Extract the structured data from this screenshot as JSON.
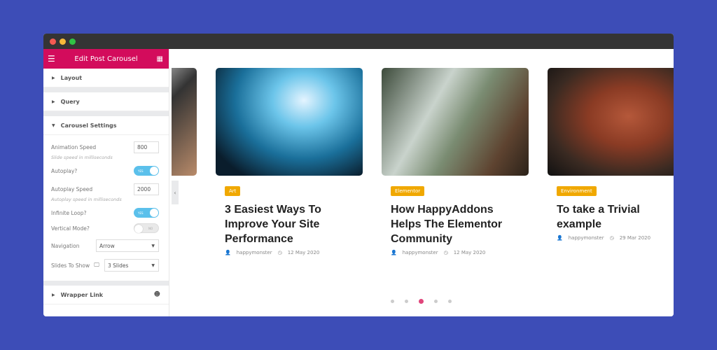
{
  "panel": {
    "title": "Edit Post Carousel",
    "sections": {
      "layout": "Layout",
      "query": "Query",
      "carousel": "Carousel Settings",
      "wrapper": "Wrapper Link"
    },
    "fields": {
      "animation_speed": {
        "label": "Animation Speed",
        "value": "800",
        "hint": "Slide speed in milliseconds"
      },
      "autoplay": {
        "label": "Autoplay?",
        "state": "YES"
      },
      "autoplay_speed": {
        "label": "Autoplay Speed",
        "value": "2000",
        "hint": "Autoplay speed in milliseconds"
      },
      "infinite_loop": {
        "label": "Infinite Loop?",
        "state": "YES"
      },
      "vertical_mode": {
        "label": "Vertical Mode?",
        "state": "NO"
      },
      "navigation": {
        "label": "Navigation",
        "value": "Arrow"
      },
      "slides_to_show": {
        "label": "Slides To Show",
        "value": "3 Slides"
      }
    }
  },
  "colors": {
    "accent": "#d30c5c",
    "toggle_on": "#5bc0eb",
    "badge": "#f0a800",
    "background": "#3d4db7"
  },
  "posts": [
    {
      "category": "Art",
      "title": "3 Easiest Ways To Improve Your Site Performance",
      "author": "happymonster",
      "date": "12 May 2020"
    },
    {
      "category": "Elementor",
      "title": "How HappyAddons Helps The Elementor Community",
      "author": "happymonster",
      "date": "12 May 2020"
    },
    {
      "category": "Environment",
      "title": "To take a Trivial example",
      "author": "happymonster",
      "date": "29 Mar 2020"
    }
  ],
  "pagination": {
    "count": 5,
    "active": 3
  }
}
